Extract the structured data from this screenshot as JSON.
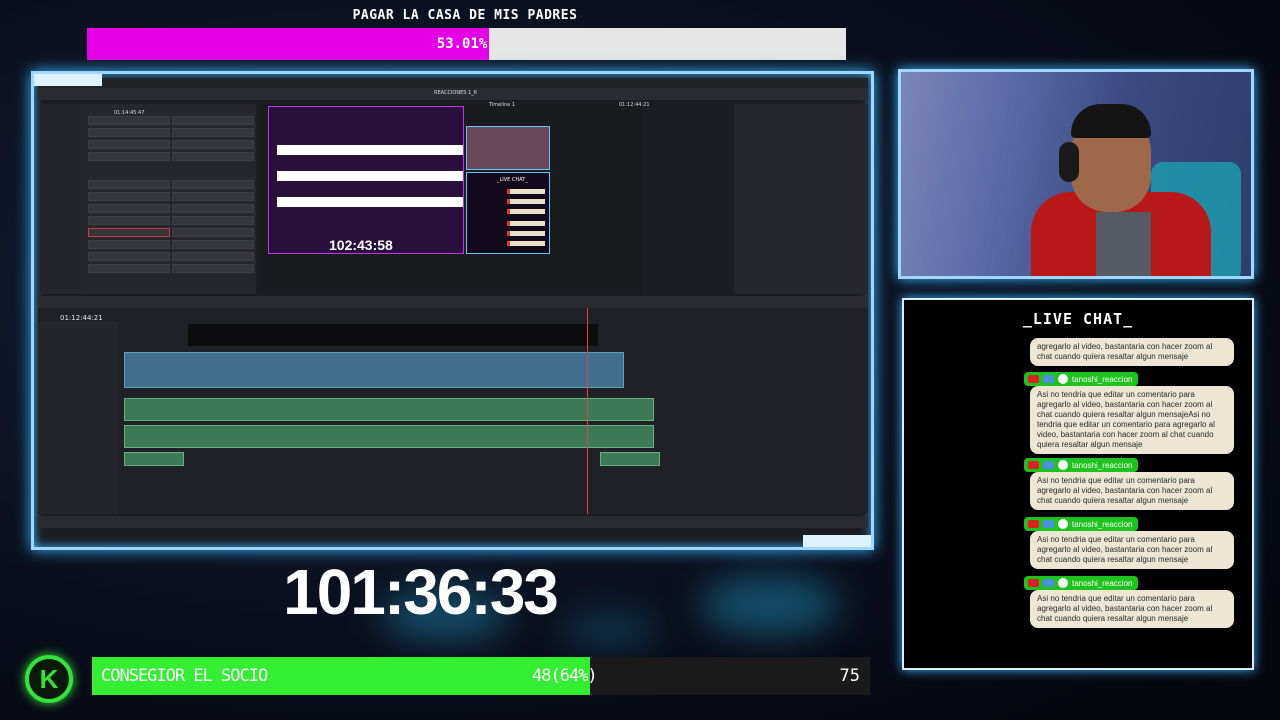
{
  "top_goal": {
    "title": "PAGAR LA CASA DE MIS PADRES",
    "percent_label": "53.01%",
    "progress": 0.5301
  },
  "editor": {
    "viewer_title": "REACCIONES 1_6",
    "timeline_name": "Timeline 1",
    "viewer_timecode_left": "01:14:45:47",
    "viewer_timecode_right": "01:12:44:21",
    "timeline_timecode": "01:12:44:21",
    "inner_timer": "102:43:58",
    "inner_chat_title": "_LIVE CHAT_"
  },
  "big_timer": "101:36:33",
  "bottom_goal": {
    "label": "CONSEGIOR EL SOCIO",
    "progress_label": "48(64%)",
    "target": "75",
    "progress": 0.64
  },
  "chat": {
    "title": "_LIVE CHAT_",
    "messages": [
      {
        "user": "",
        "text": "agregarlo al video, bastantaria con hacer zoom al chat cuando quiera resaltar algun mensaje"
      },
      {
        "user": "tanoshi_reaccion",
        "text": "Asi no tendria que editar un comentario para agregarlo al video, bastantaria con hacer zoom al chat cuando quiera resaltar algun mensajeAsi no tendria que editar un comentario para agregarlo al video, bastantaria con hacer zoom al chat cuando quiera resaltar algun mensaje"
      },
      {
        "user": "tanoshi_reaccion",
        "text": "Asi no tendria que editar un comentario para agregarlo al video, bastantaria con hacer zoom al chat cuando quiera resaltar algun mensaje"
      },
      {
        "user": "tanoshi_reaccion",
        "text": "Asi no tendria que editar un comentario para agregarlo al video, bastantaria con hacer zoom al chat cuando quiera resaltar algun mensaje"
      },
      {
        "user": "tanoshi_reaccion",
        "text": "Asi no tendria que editar un comentario para agregarlo al video, bastantaria con hacer zoom al chat cuando quiera resaltar algun mensaje"
      }
    ]
  },
  "colors": {
    "top_goal_fill": "#e600e6",
    "bottom_goal_fill": "#33ee33",
    "frame_glow": "#37b6ff",
    "kick_green": "#35e23a"
  },
  "icons": {
    "logo": "kick-logo-icon",
    "chat_badges": [
      "camera-badge-icon",
      "group-badge-icon",
      "face-badge-icon"
    ]
  }
}
